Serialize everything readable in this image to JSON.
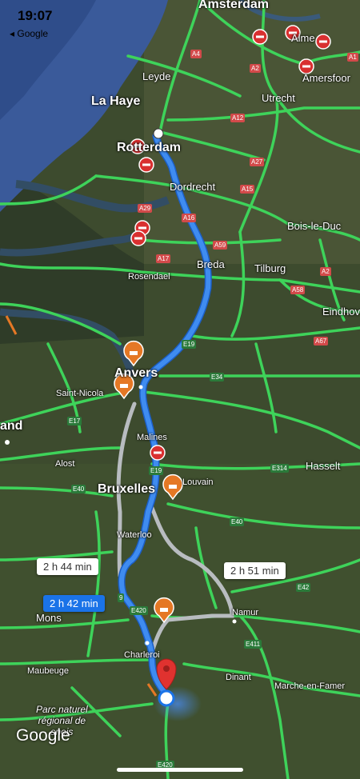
{
  "status": {
    "time": "19:07",
    "back_label": "◂ Google"
  },
  "colors": {
    "route_selected": "#3f8cf0",
    "route_alt": "#b8bcc0",
    "traffic_free": "#3ed35a",
    "closure": "#d93030"
  },
  "cities": {
    "amsterdam": "Amsterdam",
    "almere": "Alme",
    "leyde": "Leyde",
    "amersfoort": "Amersfoor",
    "la_haye": "La Haye",
    "utrecht": "Utrecht",
    "rotterdam": "Rotterdam",
    "dordrecht": "Dordrecht",
    "bois_le_duc": "Bois-le-Duc",
    "breda": "Breda",
    "tilburg": "Tilburg",
    "rosendael": "Rosendael",
    "eindhoven": "Eindhov",
    "anvers": "Anvers",
    "saint_nicolas": "Saint-Nicola",
    "land": "and",
    "malines": "Malines",
    "alost": "Alost",
    "hasselt": "Hasselt",
    "bruxelles": "Bruxelles",
    "louvain": "Louvain",
    "waterloo": "Waterloo",
    "namur": "Namur",
    "mons": "Mons",
    "charleroi": "Charleroi",
    "maubeuge": "Maubeuge",
    "dinant": "Dinant",
    "marche": "Marche-en-Famer",
    "parc": "Parc naturel\nrégional de\nsnois"
  },
  "roads": {
    "a4": "A4",
    "a2a": "A2",
    "a1": "A1",
    "a12": "A12",
    "a27": "A27",
    "a15": "A15",
    "a16": "A16",
    "a29": "A29",
    "a59": "A59",
    "a17": "A17",
    "a2b": "A2",
    "a58": "A58",
    "a67": "A67",
    "e19a": "E19",
    "e34": "E34",
    "e17": "E17",
    "e19b": "E19",
    "e314": "E314",
    "e40a": "E40",
    "e40b": "E40",
    "e42": "E42",
    "e420a": "E420",
    "e411": "E411",
    "e420b": "E420",
    "n9": "9"
  },
  "routes": [
    {
      "label": "2 h 42 min",
      "selected": true
    },
    {
      "label": "2 h 44 min",
      "selected": false
    },
    {
      "label": "2 h 51 min",
      "selected": false
    }
  ],
  "attribution": "Google"
}
